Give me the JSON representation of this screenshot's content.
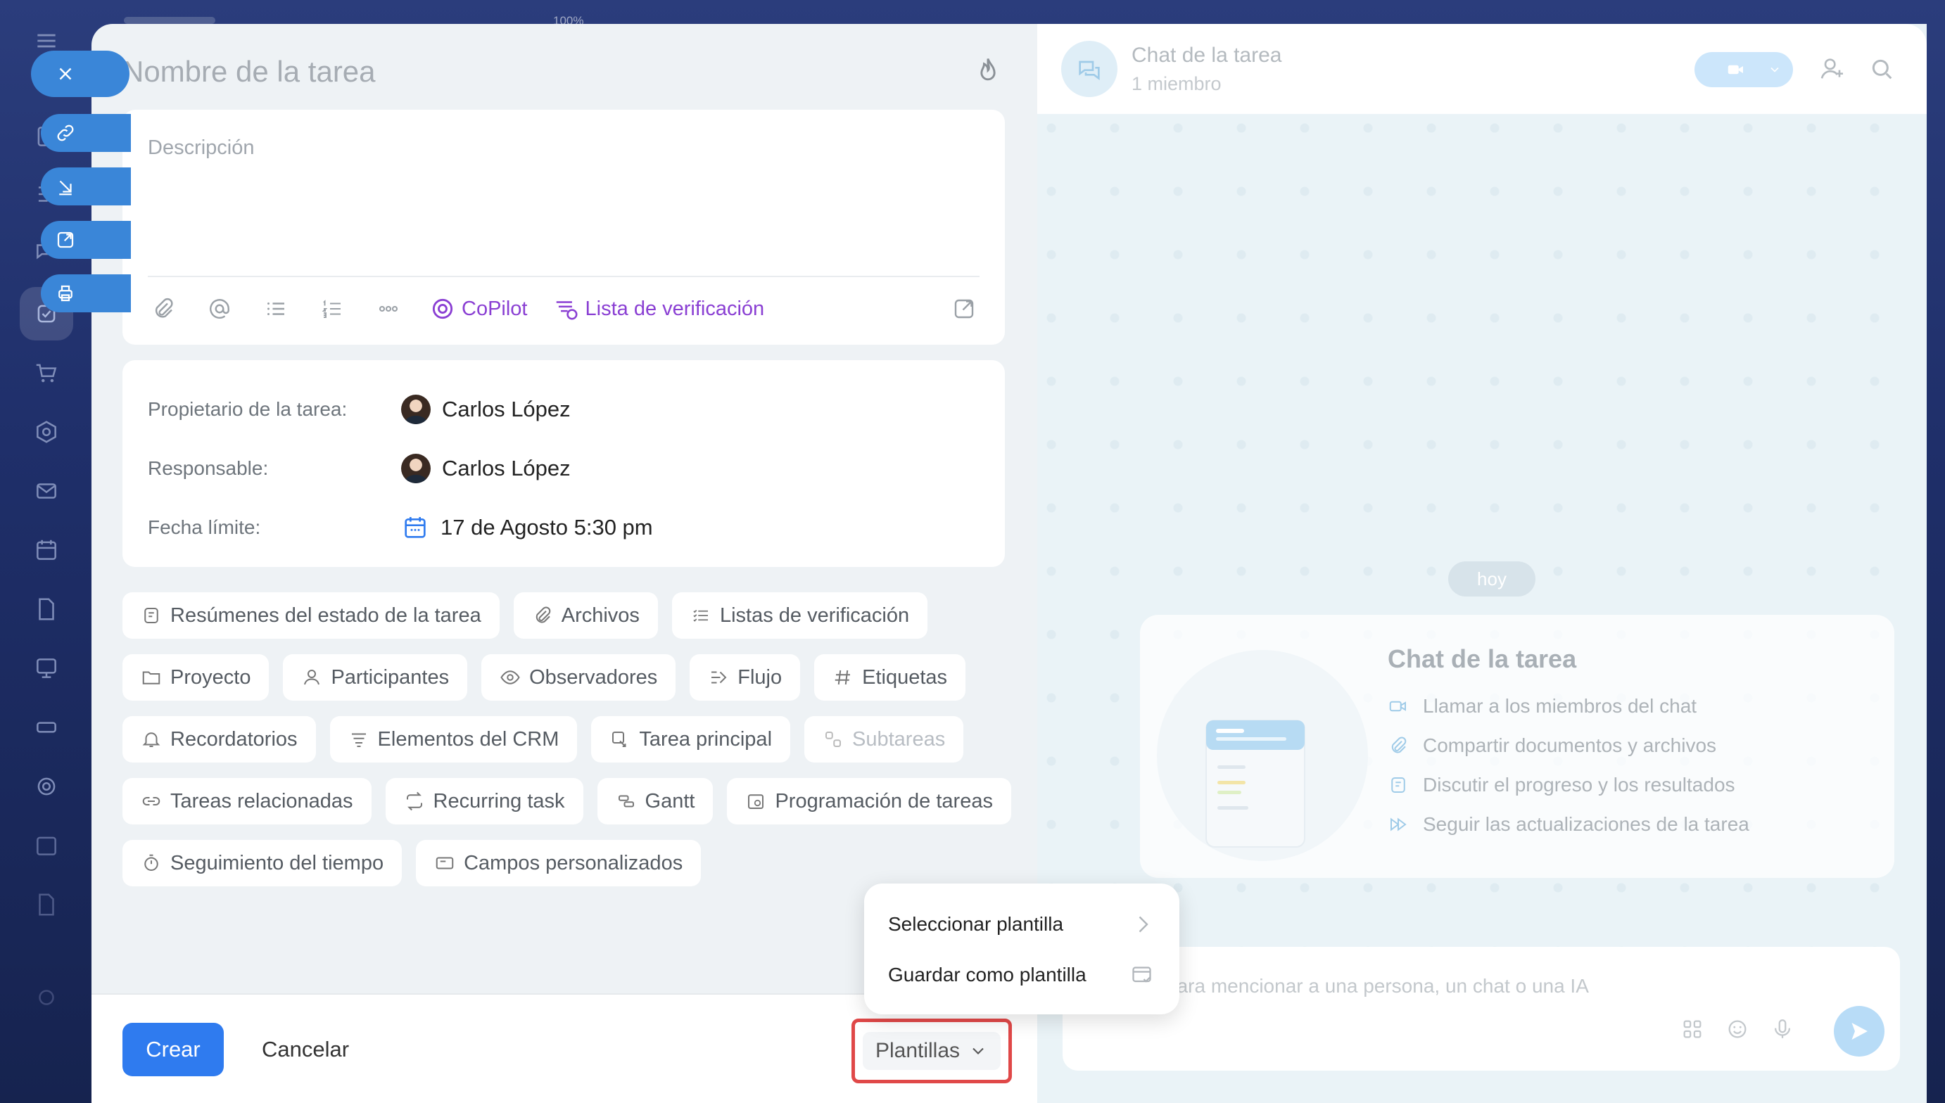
{
  "top": {
    "zoom": "100%"
  },
  "task": {
    "title_placeholder": "Nombre de la tarea",
    "description_placeholder": "Descripción",
    "toolbar": {
      "copilot": "CoPilot",
      "checklist": "Lista de verificación"
    }
  },
  "fields": [
    {
      "label": "Propietario de la tarea:",
      "value": "Carlos López"
    },
    {
      "label": "Responsable:",
      "value": "Carlos López"
    },
    {
      "label": "Fecha límite:",
      "value": "17 de Agosto 5:30 pm"
    }
  ],
  "chips": {
    "row1": [
      "Resúmenes del estado de la tarea",
      "Archivos",
      "Listas de verificación"
    ],
    "row2": [
      "Proyecto",
      "Participantes",
      "Observadores",
      "Flujo",
      "Etiquetas"
    ],
    "row3": [
      "Recordatorios",
      "Elementos del CRM",
      "Tarea principal",
      "Subtareas"
    ],
    "row4": [
      "Tareas relacionadas",
      "Recurring task",
      "Gantt",
      "Programación de tareas"
    ],
    "row5": [
      "Seguimiento del tiempo",
      "Campos personalizados"
    ]
  },
  "footer": {
    "create": "Crear",
    "cancel": "Cancelar",
    "templates": "Plantillas"
  },
  "popup": {
    "select": "Seleccionar plantilla",
    "save": "Guardar como plantilla"
  },
  "chat": {
    "title": "Chat de la tarea",
    "members": "1 miembro",
    "today": "hoy",
    "card_title": "Chat de la tarea",
    "items": [
      "Llamar a los miembros del chat",
      "Compartir documentos y archivos",
      "Discutir el progreso y los resultados",
      "Seguir las actualizaciones de la tarea"
    ],
    "composer_placeholder": "a @ o + para mencionar a una persona, un chat o una IA"
  },
  "colors": {
    "accent": "#2f7bef",
    "copilot": "#8a3fd3",
    "highlight": "#e04848"
  }
}
